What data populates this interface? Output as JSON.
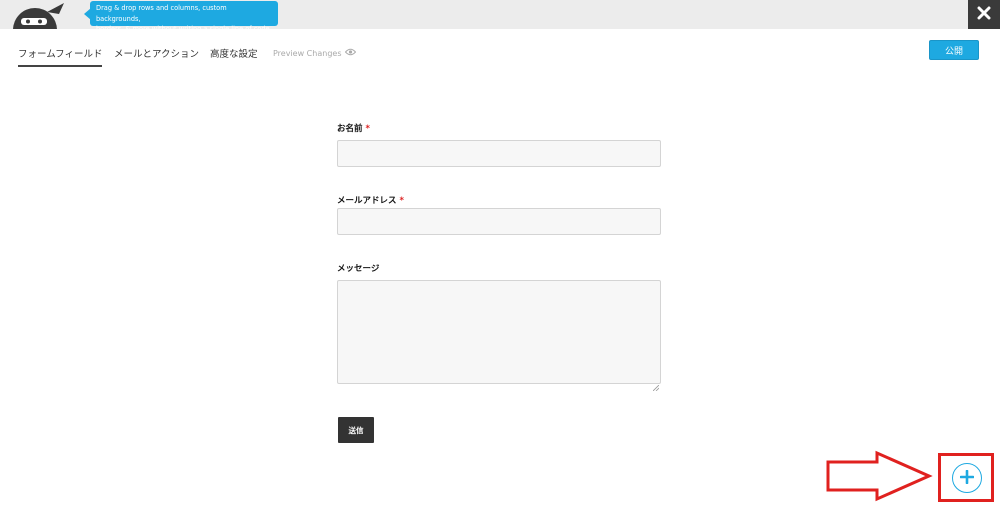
{
  "promo": {
    "text_line1": "Drag & drop rows and columns, custom backgrounds,",
    "text_line2": "borders, & more without writing a single line of code."
  },
  "tabs": [
    {
      "label": "フォームフィールド",
      "active": true
    },
    {
      "label": "メールとアクション",
      "active": false
    },
    {
      "label": "高度な設定",
      "active": false
    },
    {
      "label": "Preview Changes",
      "active": false
    }
  ],
  "publish_label": "公開",
  "form": {
    "name_label": "お名前",
    "email_label": "メールアドレス",
    "message_label": "メッセージ",
    "required_marker": "*",
    "submit_label": "送信"
  },
  "colors": {
    "accent": "#1ea9e1",
    "annotation": "#e0211f"
  },
  "icons": {
    "close": "close-icon",
    "eye": "eye-icon",
    "add": "plus-icon"
  }
}
